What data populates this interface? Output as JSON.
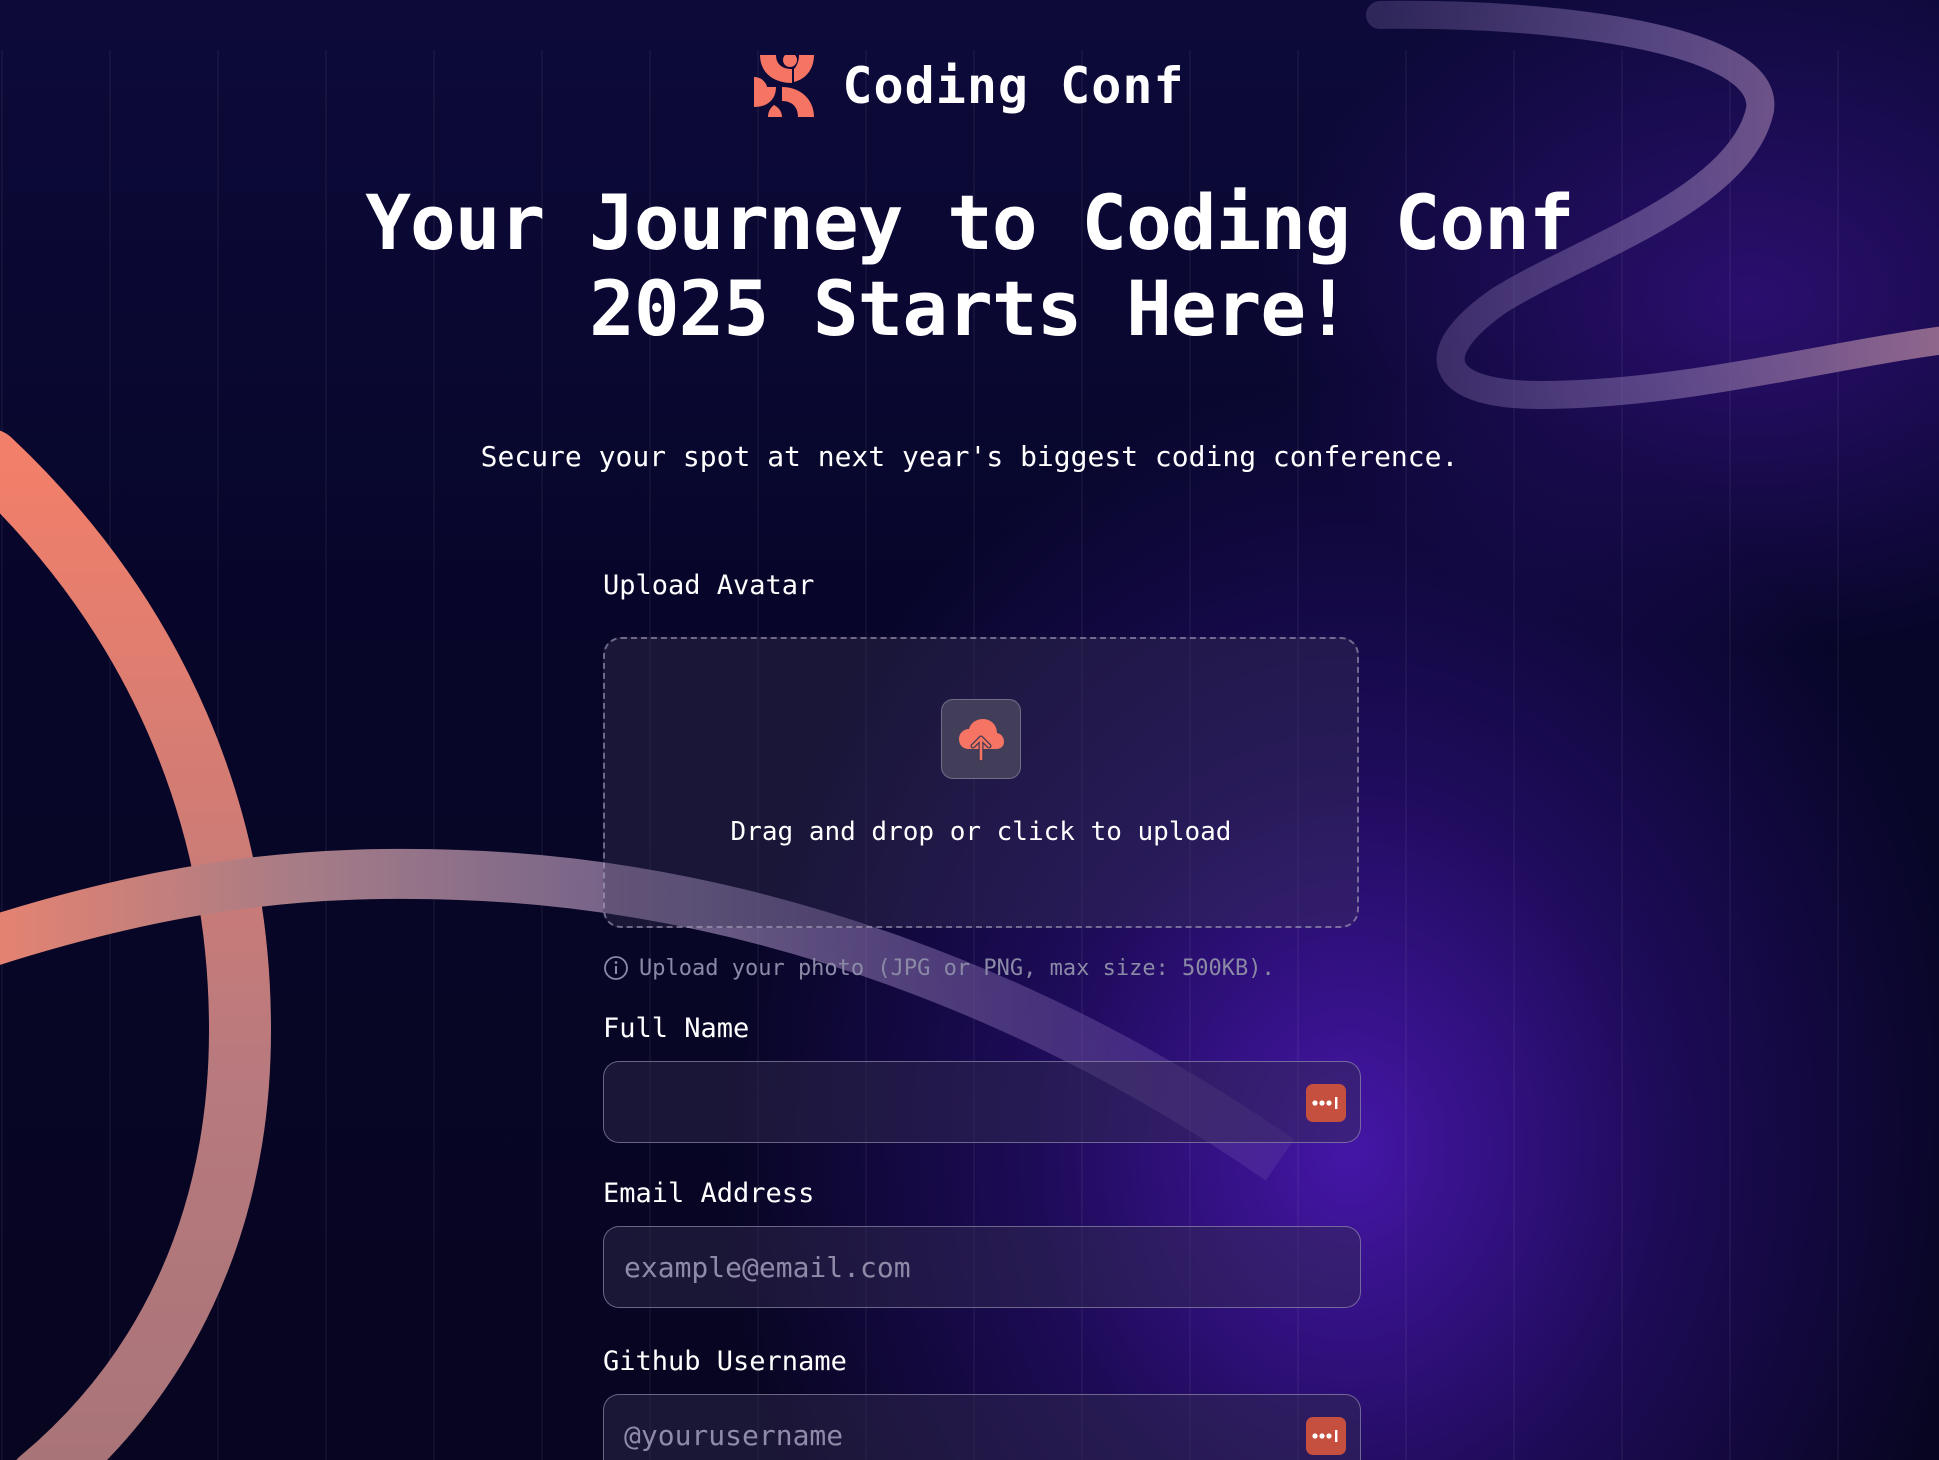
{
  "brand": {
    "name": "Coding Conf",
    "accent_color": "#f57463",
    "icon": "coding-conf-logo"
  },
  "hero": {
    "headline_line1": "Your Journey to Coding Conf",
    "headline_line2": "2025 Starts Here!",
    "subline": "Secure your spot at next year's biggest coding conference."
  },
  "form": {
    "avatar": {
      "label": "Upload Avatar",
      "drop_text": "Drag and drop or click to upload",
      "hint": "Upload your photo (JPG or PNG, max size: 500KB).",
      "icon": "upload-cloud-icon"
    },
    "full_name": {
      "label": "Full Name",
      "value": "",
      "placeholder": ""
    },
    "email": {
      "label": "Email Address",
      "value": "",
      "placeholder": "example@email.com"
    },
    "github": {
      "label": "Github Username",
      "value": "",
      "placeholder": "@yourusername"
    }
  },
  "colors": {
    "background": "#0a0920",
    "accent": "#f57463",
    "password_manager_badge": "#c5503f"
  }
}
